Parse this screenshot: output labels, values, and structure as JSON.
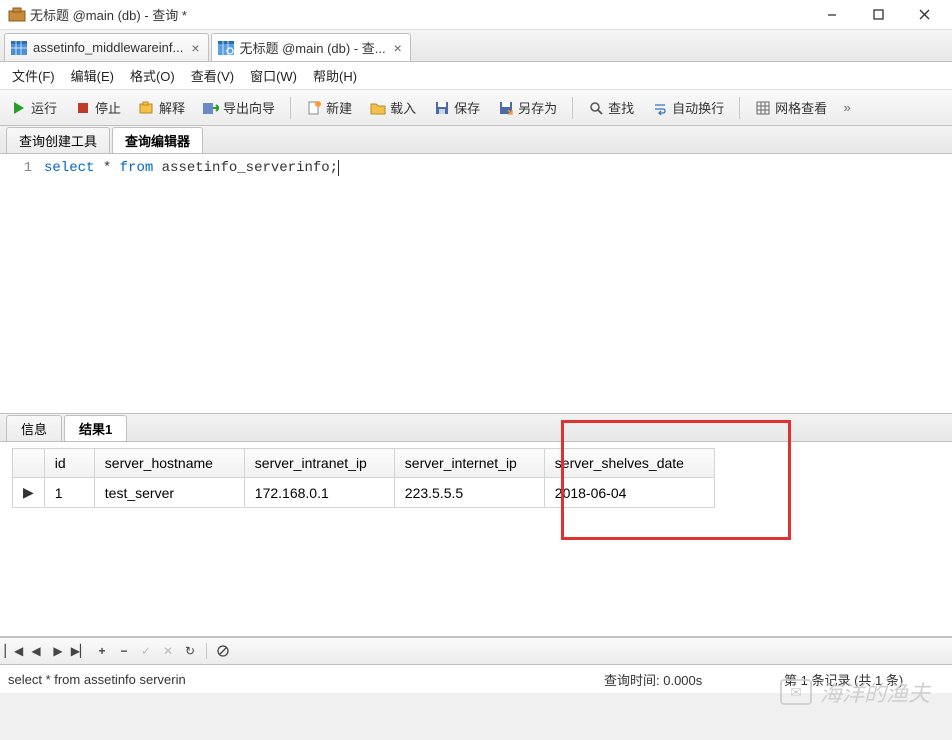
{
  "window": {
    "title": "无标题 @main (db) - 查询 *"
  },
  "filetabs": [
    {
      "label": "assetinfo_middlewareinf...",
      "active": false
    },
    {
      "label": "无标题 @main (db) - 查...",
      "active": true
    }
  ],
  "menu": {
    "file": "文件(F)",
    "edit": "编辑(E)",
    "format": "格式(O)",
    "view": "查看(V)",
    "window": "窗口(W)",
    "help": "帮助(H)"
  },
  "toolbar": {
    "run": "运行",
    "stop": "停止",
    "explain": "解释",
    "export_wizard": "导出向导",
    "new": "新建",
    "load": "载入",
    "save": "保存",
    "save_as": "另存为",
    "find": "查找",
    "auto_wrap": "自动换行",
    "grid_view": "网格查看"
  },
  "editor_tabs": {
    "builder": "查询创建工具",
    "editor": "查询编辑器"
  },
  "editor": {
    "line_no": "1",
    "kw1": "select",
    "mid": " * ",
    "kw2": "from",
    "rest": " assetinfo_serverinfo;"
  },
  "result_tabs": {
    "info": "信息",
    "result1": "结果1"
  },
  "grid": {
    "cols": [
      "id",
      "server_hostname",
      "server_intranet_ip",
      "server_internet_ip",
      "server_shelves_date"
    ],
    "rows": [
      {
        "id": "1",
        "server_hostname": "test_server",
        "server_intranet_ip": "172.168.0.1",
        "server_internet_ip": "223.5.5.5",
        "server_shelves_date": "2018-06-04"
      }
    ]
  },
  "status": {
    "left": "select * from assetinfo serverin",
    "mid": "查询时间: 0.000s",
    "right": "第 1 条记录 (共 1 条)"
  },
  "watermark": "海洋的渔夫"
}
